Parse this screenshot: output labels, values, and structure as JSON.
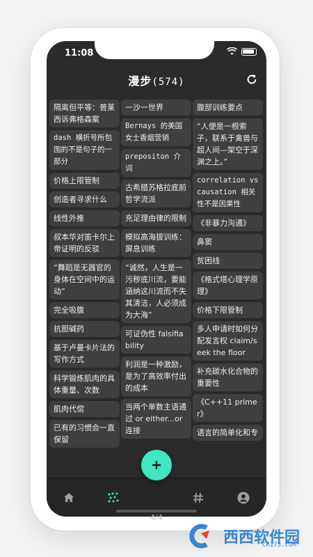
{
  "status": {
    "time": "11:08"
  },
  "header": {
    "title": "漫步",
    "count": "(574)"
  },
  "columns": [
    [
      "隔离但平等：普莱西诉弗格森案",
      "dash 横折号所包围的不是句子的一部分",
      "价格上限管制",
      "创造者寻求什么",
      "线性外推",
      "叔本华对笛卡尔上帝证明的反驳",
      "“舞蹈是无器官的身体在空间中的运动”",
      "完全吸腹",
      "抗胆碱药",
      "基于卢曼卡片法的写作方式",
      "科学锻炼肌肉的具体重量、次数",
      "肌肉代偿",
      "已有的习惯会一直保留"
    ],
    [
      "一沙一世界",
      "Bernays 的美国女士香烟营销",
      "prepositon 介词",
      "古希腊苏格拉底前哲学流派",
      "充足理由律的限制",
      "模拟高海拔训练：屏息训练",
      "“诚然，人生是一污秽底川流，要能涵纳这川流而不失其清洁，人必须成为大海”",
      "可证伪性 falsifiability",
      "利润是一种激励，是为了高效率付出的成本",
      "当两个单数主语通过 or either...or 连接"
    ],
    [
      "腹部训练要点",
      "“人便是一根索子，联系于禽兽与超人间—架空于深渊之上。”",
      "correlation vs causation 相关性不是因果性",
      "《非暴力沟通》",
      "鼻窦",
      "贫困线",
      "《格式塔心理学原理》",
      "价格下限管制",
      "多人申请时如何分配发言权 claim/seek the floor",
      "补充碳水化合物的重要性",
      "《C++11 primer》",
      "语言的简单化和专"
    ]
  ],
  "tabs": [
    "home-icon",
    "grid-dots-icon",
    "hash-icon",
    "user-icon"
  ],
  "pager": "4/4",
  "watermark": {
    "brand": "西西软件园",
    "url": "CR173.COM"
  },
  "colors": {
    "accent": "#3fe6c2",
    "background": "#2b2b2b",
    "card": "#3f3f3f"
  }
}
